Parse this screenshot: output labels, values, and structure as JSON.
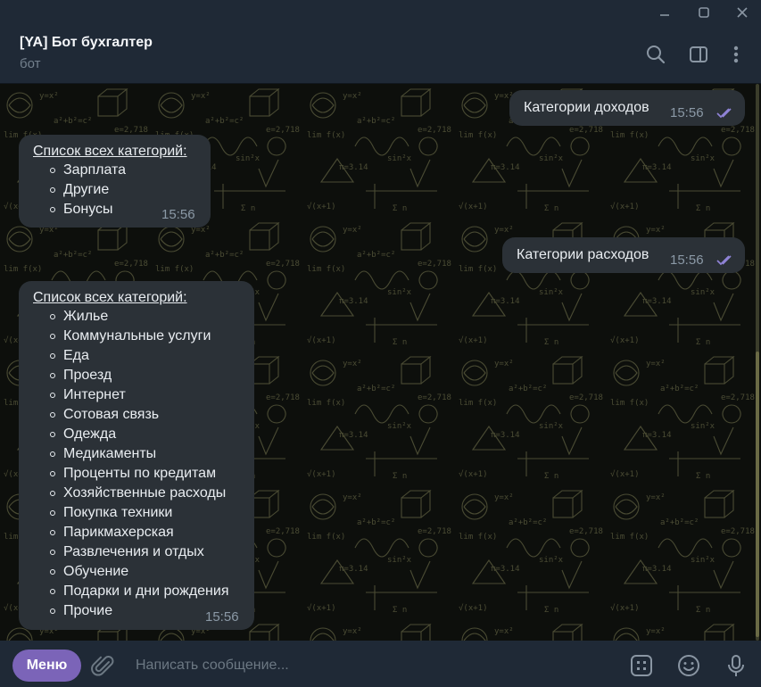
{
  "window": {
    "controls": [
      "minimize-icon",
      "maximize-icon",
      "close-icon"
    ]
  },
  "header": {
    "title": "[YA] Бот бухгалтер",
    "subtitle": "бот",
    "icons": [
      "search-icon",
      "sidebar-toggle-icon",
      "more-vert-icon"
    ]
  },
  "messages": [
    {
      "direction": "outgoing",
      "text": "Категории доходов",
      "time": "15:56",
      "status": "read"
    },
    {
      "direction": "incoming",
      "title": "Список всех категорий",
      "title_suffix": ":",
      "items": [
        "Зарплата",
        "Другие",
        "Бонусы"
      ],
      "time": "15:56"
    },
    {
      "direction": "outgoing",
      "text": "Категории расходов",
      "time": "15:56",
      "status": "read"
    },
    {
      "direction": "incoming",
      "title": "Список всех категорий",
      "title_suffix": ":",
      "items": [
        "Жилье",
        "Коммунальные услуги",
        "Еда",
        "Проезд",
        "Интернет",
        "Сотовая связь",
        "Одежда",
        "Медикаменты",
        "Проценты по кредитам",
        "Хозяйственные расходы",
        "Покупка техники",
        "Парикмахерская",
        "Развлечения и отдых",
        "Обучение",
        "Подарки и дни рождения",
        "Прочие"
      ],
      "time": "15:56"
    }
  ],
  "composer": {
    "menu_label": "Меню",
    "placeholder": "Написать сообщение...",
    "icons": [
      "attach-icon",
      "bot-commands-icon",
      "emoji-icon",
      "microphone-icon"
    ]
  },
  "colors": {
    "accent": "#7b64b8",
    "header_bg": "#1f2936",
    "bubble_bg": "#2b3137",
    "read_checks": "#8f83d6",
    "chat_bg": "#0d0f0c",
    "doodle": "#4a4b33"
  }
}
